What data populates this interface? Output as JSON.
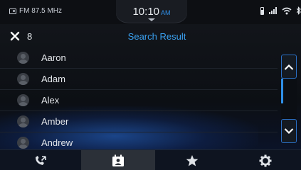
{
  "status_bar": {
    "radio_text": "FM 87.5 MHz",
    "time": "10:10",
    "ampm": "AM",
    "icons": [
      "battery-icon",
      "signal-icon",
      "wifi-icon"
    ]
  },
  "header": {
    "close_icon": "close-icon",
    "result_count": "8",
    "title": "Search Result"
  },
  "contacts": [
    {
      "name": "Aaron"
    },
    {
      "name": "Adam"
    },
    {
      "name": "Alex"
    },
    {
      "name": "Amber"
    },
    {
      "name": "Andrew"
    }
  ],
  "scroll": {
    "position": 0.0
  },
  "nav": {
    "items": [
      "recent-calls-icon",
      "contacts-icon",
      "favorites-icon",
      "settings-icon"
    ],
    "active_index": 1
  },
  "colors": {
    "accent": "#2f8fe8"
  }
}
